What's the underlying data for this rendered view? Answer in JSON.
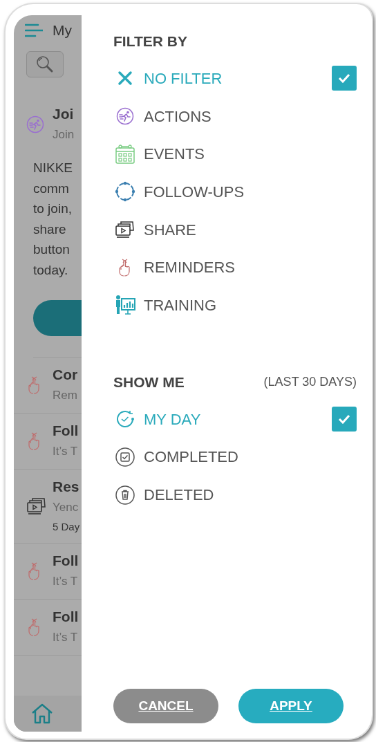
{
  "background_screen": {
    "title": "My",
    "paragraph_lines": [
      "NIKKE",
      "comm",
      "to join,",
      "share",
      "button",
      "today."
    ],
    "items": [
      {
        "kind": "actions",
        "title": "Joi",
        "subtitle": "Join"
      },
      {
        "kind": "reminders",
        "title": "Cor",
        "subtitle": "Rem"
      },
      {
        "kind": "reminders",
        "title": "Foll",
        "subtitle": "It’s T"
      },
      {
        "kind": "share",
        "title": "Res",
        "subtitle": "Yenc",
        "meta": "5 Day"
      },
      {
        "kind": "reminders",
        "title": "Foll",
        "subtitle": "It’s T"
      },
      {
        "kind": "reminders",
        "title": "Foll",
        "subtitle": "It’s T"
      }
    ]
  },
  "filter_by": {
    "heading": "FILTER BY",
    "options": [
      {
        "kind": "no-filter",
        "label": "NO FILTER",
        "selected": true
      },
      {
        "kind": "actions",
        "label": "ACTIONS",
        "selected": false
      },
      {
        "kind": "events",
        "label": "EVENTS",
        "selected": false
      },
      {
        "kind": "follow-ups",
        "label": "FOLLOW-UPS",
        "selected": false
      },
      {
        "kind": "share",
        "label": "SHARE",
        "selected": false
      },
      {
        "kind": "reminders",
        "label": "REMINDERS",
        "selected": false
      },
      {
        "kind": "training",
        "label": "TRAINING",
        "selected": false
      }
    ]
  },
  "show_me": {
    "heading": "SHOW ME",
    "note": "(LAST 30 DAYS)",
    "options": [
      {
        "kind": "my-day",
        "label": "MY DAY",
        "selected": true
      },
      {
        "kind": "completed",
        "label": "COMPLETED",
        "selected": false
      },
      {
        "kind": "deleted",
        "label": "DELETED",
        "selected": false
      }
    ]
  },
  "buttons": {
    "cancel": "CANCEL",
    "apply": "APPLY"
  }
}
